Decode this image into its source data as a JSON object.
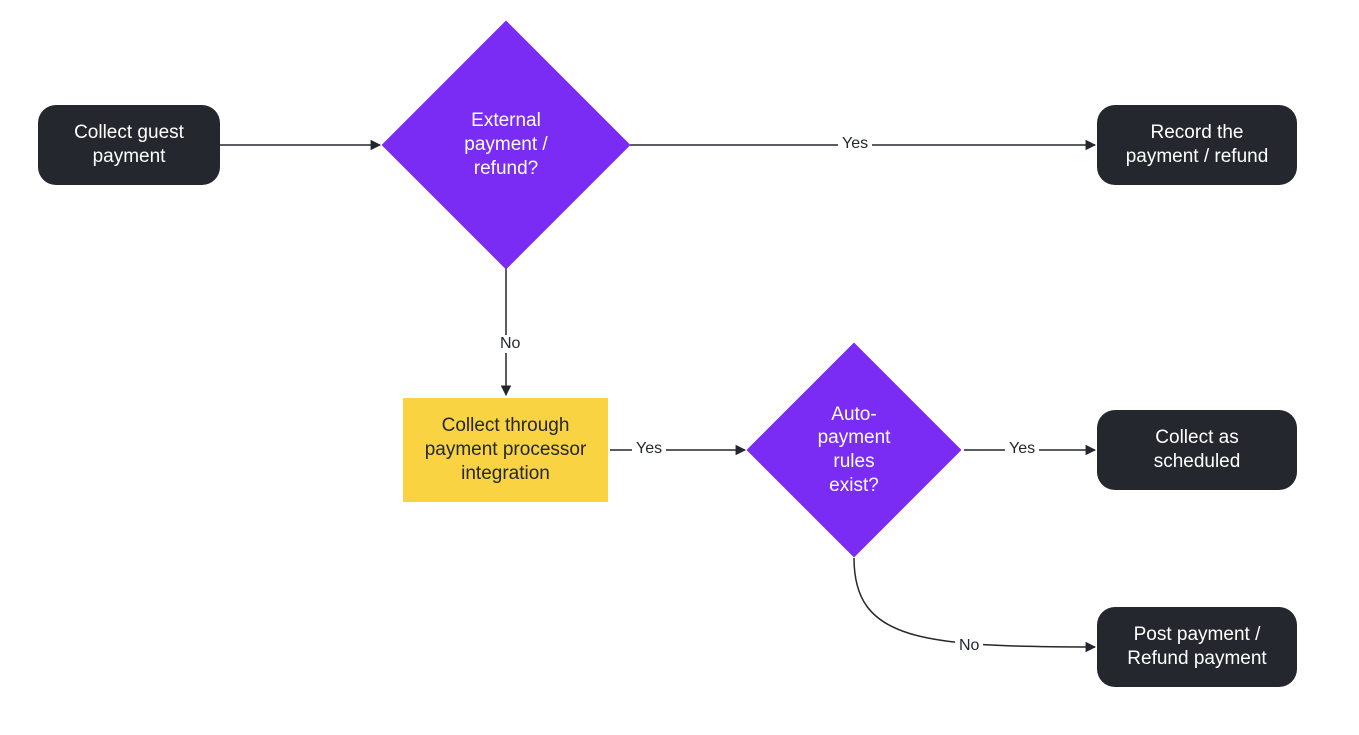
{
  "nodes": {
    "start": {
      "label": "Collect guest\npayment"
    },
    "decision1": {
      "label": "External\npayment /\nrefund?"
    },
    "record": {
      "label": "Record the\npayment / refund"
    },
    "process": {
      "label": "Collect through\npayment processor\nintegration"
    },
    "decision2": {
      "label": "Auto-\npayment\nrules\nexist?"
    },
    "scheduled": {
      "label": "Collect as\nscheduled"
    },
    "post": {
      "label": "Post payment /\nRefund payment"
    }
  },
  "edges": {
    "d1_yes": "Yes",
    "d1_no": "No",
    "p_yes": "Yes",
    "d2_yes": "Yes",
    "d2_no": "No"
  },
  "colors": {
    "terminal": "#25272e",
    "decision": "#7a2cf5",
    "process": "#f9d342",
    "edge": "#25272e"
  }
}
